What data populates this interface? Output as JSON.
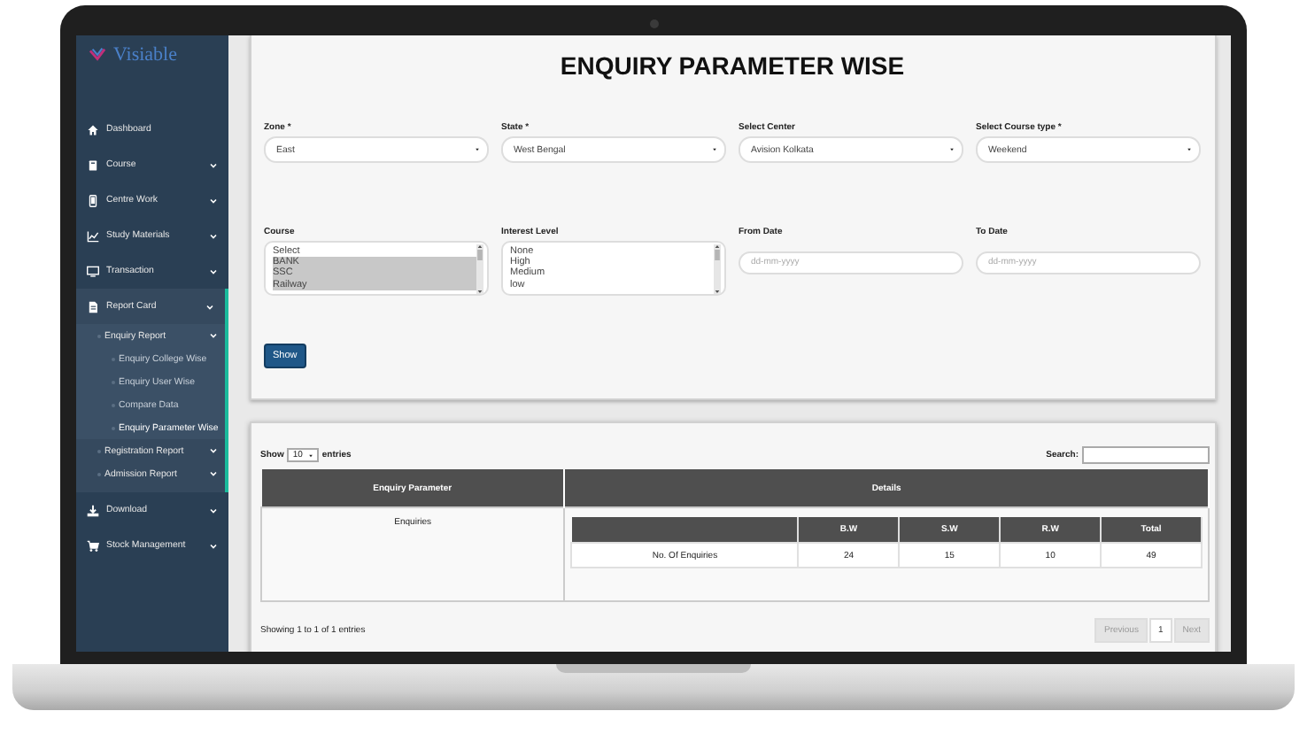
{
  "logo": {
    "text": "Visiable"
  },
  "sidebar": {
    "items": [
      {
        "kind": "link",
        "label": "Dashboard"
      },
      {
        "kind": "group",
        "label": "Course",
        "expanded": false
      },
      {
        "kind": "group",
        "label": "Centre Work",
        "expanded": false
      },
      {
        "kind": "group",
        "label": "Study Materials",
        "expanded": false
      },
      {
        "kind": "group",
        "label": "Transaction",
        "expanded": false
      },
      {
        "kind": "group",
        "label": "Report Card",
        "expanded": true,
        "children": [
          {
            "label": "Enquiry Report",
            "expanded": true,
            "children": [
              {
                "label": "Enquiry College Wise",
                "selected": false
              },
              {
                "label": "Enquiry User Wise",
                "selected": false
              },
              {
                "label": "Compare Data",
                "selected": false
              },
              {
                "label": "Enquiry Parameter Wise",
                "selected": true
              }
            ]
          },
          {
            "label": "Registration Report",
            "expanded": false
          },
          {
            "label": "Admission Report",
            "expanded": false
          }
        ]
      },
      {
        "kind": "group",
        "label": "Download",
        "expanded": false
      },
      {
        "kind": "group",
        "label": "Stock Management",
        "expanded": false
      }
    ]
  },
  "form": {
    "title": "ENQUIRY PARAMETER WISE",
    "fields": [
      {
        "kind": "select",
        "label": "Zone *",
        "value": "East"
      },
      {
        "kind": "select",
        "label": "State *",
        "value": "West Bengal"
      },
      {
        "kind": "select",
        "label": "Select Center",
        "value": "Avision Kolkata"
      },
      {
        "kind": "select",
        "label": "Select Course type *",
        "value": "Weekend"
      },
      {
        "kind": "listbox",
        "label": "Course",
        "options": [
          {
            "label": "Select",
            "selected": false
          },
          {
            "label": "BANK",
            "selected": true
          },
          {
            "label": "SSC",
            "selected": true
          },
          {
            "label": "Railway",
            "selected": true
          }
        ]
      },
      {
        "kind": "listbox",
        "label": "Interest Level",
        "options": [
          {
            "label": "None",
            "selected": false
          },
          {
            "label": "High",
            "selected": false
          },
          {
            "label": "Medium",
            "selected": false
          },
          {
            "label": "low",
            "selected": false
          }
        ]
      },
      {
        "kind": "date",
        "label": "From Date",
        "placeholder": "dd-mm-yyyy"
      },
      {
        "kind": "date",
        "label": "To Date",
        "placeholder": "dd-mm-yyyy"
      }
    ],
    "button": "Show"
  },
  "table": {
    "show_label": "Show",
    "page_size": "10",
    "entries_label": "entries",
    "search_label": "Search:",
    "columns": [
      "Enquiry Parameter",
      "Details"
    ],
    "rows": [
      {
        "parameter": "Enquiries",
        "details": {
          "columns": [
            "",
            "B.W",
            "S.W",
            "R.W",
            "Total"
          ],
          "rows": [
            [
              "No. Of Enquiries",
              "24",
              "15",
              "10",
              "49"
            ]
          ]
        }
      }
    ],
    "info": "Showing 1 to 1 of 1 entries",
    "pagination": [
      {
        "label": "Previous",
        "disabled": true
      },
      {
        "label": "1",
        "disabled": false
      },
      {
        "label": "Next",
        "disabled": true
      }
    ]
  }
}
